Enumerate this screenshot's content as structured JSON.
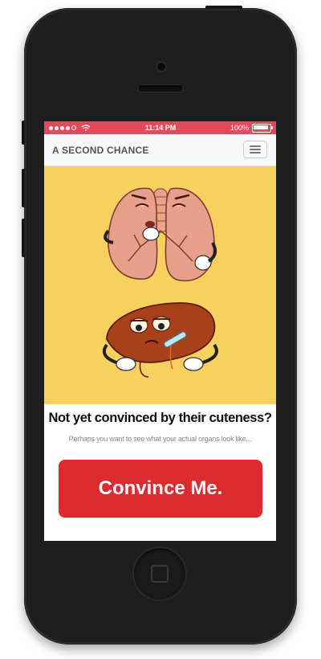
{
  "status_bar": {
    "time": "11:14 PM",
    "battery_percent": "100%",
    "signal_dots": 5,
    "signal_filled": 4
  },
  "navbar": {
    "brand": "A SECOND CHANCE",
    "menu_icon": "hamburger-menu-icon"
  },
  "hero": {
    "background": "#f8d060",
    "illustrations": [
      "cartoon-lungs-icon",
      "cartoon-liver-icon"
    ]
  },
  "content": {
    "headline": "Not yet convinced by their cuteness?",
    "subline": "Perhaps you want to see what your actual organs look like...",
    "cta_label": "Convince Me."
  },
  "colors": {
    "status_bar": "#e04b5b",
    "cta": "#dd2a2f",
    "phone": "#1e1e1f"
  }
}
